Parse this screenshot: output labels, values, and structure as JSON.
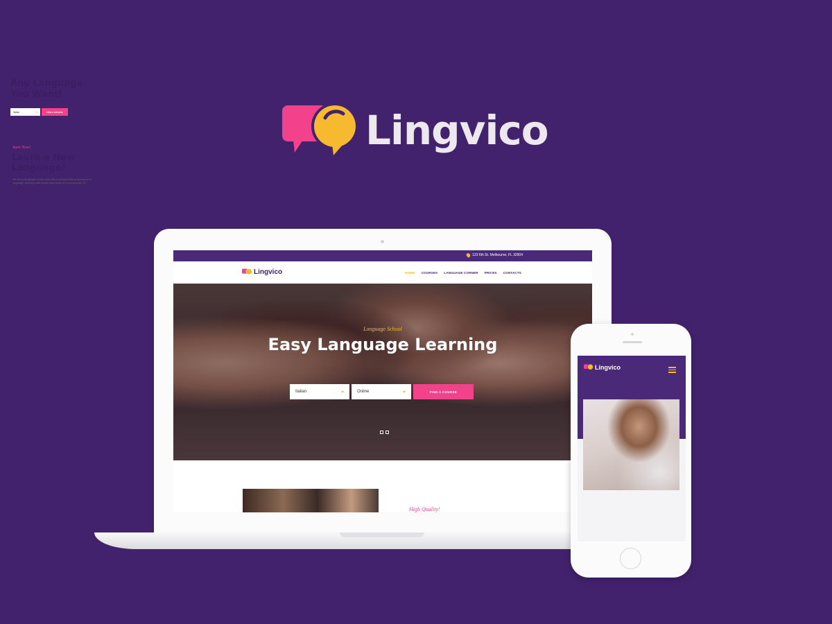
{
  "brand": {
    "name": "Lingvico",
    "colors": {
      "pink": "#f2428b",
      "yellow": "#f6b930",
      "purple": "#43226d",
      "text": "#ece8ee"
    }
  },
  "laptop": {
    "topbar": {
      "address": "123 6th St. Melbourne, FL 32904",
      "icon": "location-pin-icon"
    },
    "navbar": {
      "logo_text": "Lingvico",
      "menu": [
        {
          "label": "HOME",
          "active": true
        },
        {
          "label": "COURSES",
          "active": false
        },
        {
          "label": "LANGUAGE CORNER",
          "active": false
        },
        {
          "label": "PRICES",
          "active": false
        },
        {
          "label": "CONTACTS",
          "active": false
        }
      ]
    },
    "hero": {
      "kicker": "Language School",
      "title": "Easy Language Learning",
      "form": {
        "language_select": "Italian",
        "mode_select": "Online",
        "button": "FIND A COURSE"
      },
      "slider_dots": 2
    },
    "about": {
      "kicker": "High Quality!"
    }
  },
  "phone": {
    "logo_text": "Lingvico",
    "menu_icon": "hamburger-icon",
    "hero": {
      "title": "Any Language You Want!",
      "form": {
        "language_select": "Italian",
        "button": "FIND A COURSE"
      }
    },
    "section": {
      "kicker": "Start Now!",
      "title": "Learn a New Language!",
      "body": "We are a language centre that offers a personalized approach to language learning with small class sizes of no more than 10."
    }
  }
}
